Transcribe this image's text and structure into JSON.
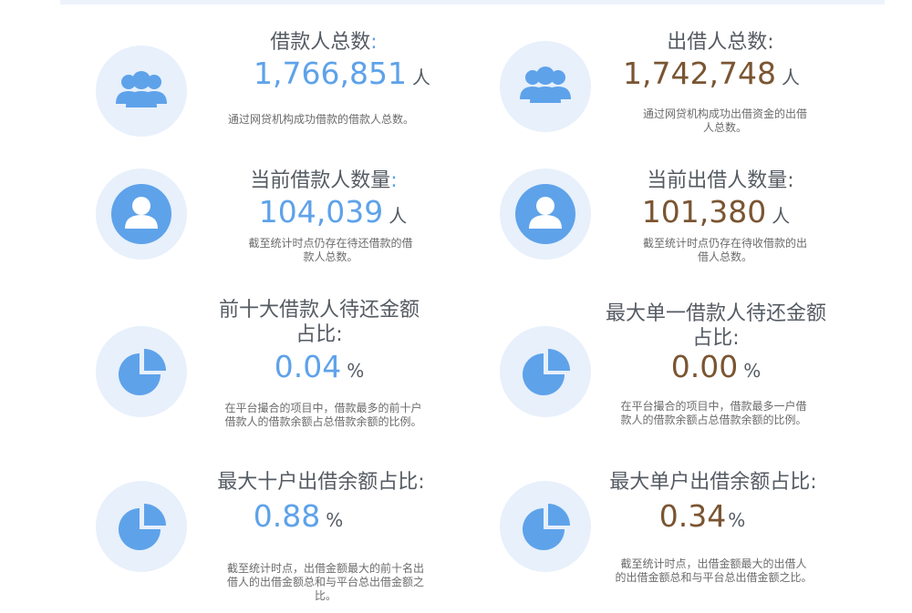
{
  "colors": {
    "accent_blue": "#5ea2ea",
    "accent_brown": "#7a5532",
    "icon_bg": "#e7f0fb"
  },
  "cards": [
    {
      "icon": "users-icon",
      "title": "借款人总数",
      "colon": ":",
      "value": "1,766,851",
      "unit": "人",
      "desc": "通过网贷机构成功借款的借款人总数。"
    },
    {
      "icon": "users-icon",
      "title": "出借人总数",
      "colon": ":",
      "value": "1,742,748",
      "unit": "人",
      "desc_lines": [
        "通过网贷机构成功出借资金的出借",
        "人总数。"
      ]
    },
    {
      "icon": "user-icon",
      "title": "当前借款人数量",
      "colon": ":",
      "value": "104,039",
      "unit": "人",
      "desc_lines": [
        "截至统计时点仍存在待还借款的借",
        "款人总数。"
      ]
    },
    {
      "icon": "user-icon",
      "title": "当前出借人数量",
      "colon": ":",
      "value": "101,380",
      "unit": "人",
      "desc_lines": [
        "截至统计时点仍存在待收借款的出",
        "借人总数。"
      ]
    },
    {
      "icon": "pie-chart-icon",
      "title_lines": [
        "前十大借款人待还金额",
        "占比:"
      ],
      "value": "0.04",
      "unit": "%",
      "desc_lines": [
        "在平台撮合的项目中，借款最多的前十户",
        "借款人的借款余额占总借款余额的比例。"
      ]
    },
    {
      "icon": "pie-chart-icon",
      "title_lines": [
        "最大单一借款人待还金额",
        "占比:"
      ],
      "value": "0.00",
      "unit": "%",
      "desc_lines": [
        "在平台撮合的项目中，借款最多一户借",
        "款人的借款余额占总借款余额的比例。"
      ]
    },
    {
      "icon": "pie-chart-icon",
      "title": "最大十户出借余额占比",
      "colon": ":",
      "value": "0.88",
      "unit": "%",
      "desc_lines": [
        "截至统计时点，出借金额最大的前十名出",
        "借人的出借金额总和与平台总出借金额之",
        "比。"
      ]
    },
    {
      "icon": "pie-chart-icon",
      "title": "最大单户出借余额占比",
      "colon": ":",
      "value": "0.34",
      "unit": "%",
      "desc_lines": [
        "截至统计时点，出借金额最大的出借人",
        "的出借金额总和与平台总出借金额之比。"
      ]
    }
  ]
}
